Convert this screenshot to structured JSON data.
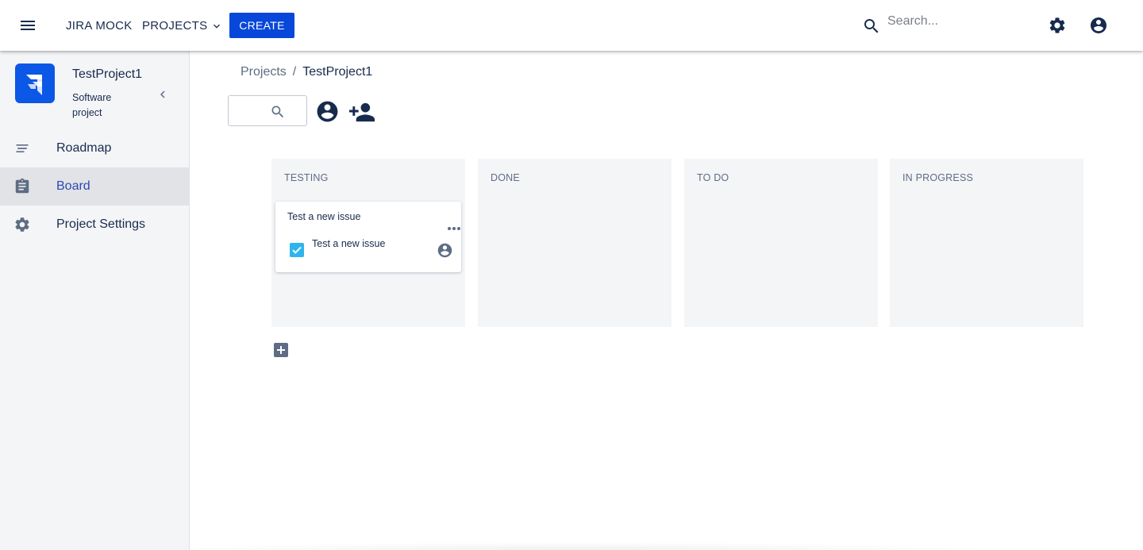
{
  "topbar": {
    "app_name": "JIRA MOCK",
    "projects_label": "PROJECTS",
    "create_label": "CREATE",
    "search_placeholder": "Search...",
    "icons": [
      "menu-icon",
      "chevron-down-icon",
      "search-icon",
      "gear-icon",
      "account-circle-icon"
    ],
    "accent_color": "#0747d9"
  },
  "sidebar": {
    "project_name": "TestProject1",
    "project_type": "Software project",
    "items": [
      {
        "label": "Roadmap",
        "icon": "roadmap-icon",
        "active": false
      },
      {
        "label": "Board",
        "icon": "clipboard-icon",
        "active": true
      },
      {
        "label": "Project Settings",
        "icon": "gear-icon",
        "active": false
      }
    ],
    "active_color": "#2b48b8"
  },
  "breadcrumb": {
    "root": "Projects",
    "separator": "/",
    "current": "TestProject1"
  },
  "board": {
    "columns": [
      {
        "title": "TESTING",
        "cards": [
          {
            "title": "Test a new issue",
            "key": "Test a new issue",
            "type_icon": "checkbox-icon",
            "assignee_icon": "account-circle-icon"
          }
        ]
      },
      {
        "title": "DONE",
        "cards": []
      },
      {
        "title": "TO DO",
        "cards": []
      },
      {
        "title": "IN PROGRESS",
        "cards": []
      }
    ],
    "task_color": "#2fb5ec"
  }
}
